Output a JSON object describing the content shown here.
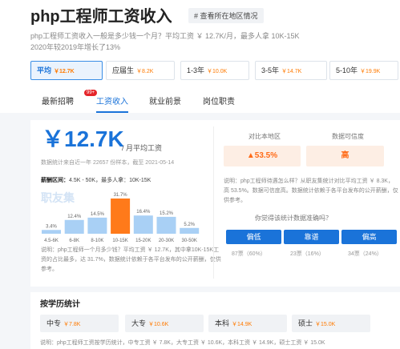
{
  "header": {
    "title": "php工程师工资收入",
    "region_link": "# 查看所在地区情况",
    "desc_line1": "php工程师工资收入一般是多少钱一个月？平均工资 ￥ 12.7K/月，最多人拿 10K-15K",
    "desc_line2": "2020年较2019年增长了13%"
  },
  "experience": [
    {
      "label": "平均",
      "value": "￥12.7K"
    },
    {
      "label": "应届生",
      "value": "￥8.2K"
    },
    {
      "label": "1-3年",
      "value": "￥10.0K"
    },
    {
      "label": "3-5年",
      "value": "￥14.7K"
    },
    {
      "label": "5-10年",
      "value": "￥19.9K"
    }
  ],
  "tabs": [
    {
      "label": "最新招聘",
      "badge": "99+"
    },
    {
      "label": "工资收入"
    },
    {
      "label": "就业前景"
    },
    {
      "label": "岗位职责"
    }
  ],
  "summary": {
    "salary": "￥12.7K",
    "unit": "/ 月平均工资",
    "stat": "数据统计来自近一年 22657 份样本，截至 2021-05-14",
    "range_label": "薪酬区间：",
    "range_text": "4.5K - 50K，最多人拿：10K-15K",
    "watermark": "职友集",
    "note": "说明：php工程师一个月多少钱？平均工资 ￥ 12.7K，其中拿10K-15K工资的占比最多，达 31.7%，数据统计依赖于各平台发布的公开薪酬，仅供参考。"
  },
  "chart_data": {
    "type": "bar",
    "categories": [
      "4.5-6K",
      "6-8K",
      "8-10K",
      "10-15K",
      "15-20K",
      "20-30K",
      "30-50K"
    ],
    "values": [
      3.4,
      12.4,
      14.5,
      31.7,
      16.4,
      15.2,
      5.2
    ],
    "labels": [
      "3.4%",
      "12.4%",
      "14.5%",
      "31.7%",
      "16.4%",
      "15.2%",
      "5.2%"
    ],
    "highlight_index": 3,
    "colors": {
      "normal": "#a9d0f5",
      "highlight": "#ff7a1a"
    }
  },
  "compare": {
    "local_label": "对比本地区",
    "local_value": "▲53.5%",
    "cred_label": "数据可信度",
    "cred_value": "高",
    "note": "说明：php工程师待遇怎么样？从职友集统计对比平均工资 ￥ 8.3K，高 53.5%。数据可信度高。数据统计依赖于各平台发布的公开薪酬，仅供参考。",
    "question": "你觉得该统计数据准确吗？",
    "votes": [
      {
        "label": "偏低",
        "count": "87票（60%）"
      },
      {
        "label": "靠谱",
        "count": "23票（16%）"
      },
      {
        "label": "偏高",
        "count": "34票（24%）"
      }
    ]
  },
  "education": {
    "title": "按学历统计",
    "items": [
      {
        "label": "中专",
        "value": "￥7.8K"
      },
      {
        "label": "大专",
        "value": "￥10.6K"
      },
      {
        "label": "本科",
        "value": "￥14.9K"
      },
      {
        "label": "硕士",
        "value": "￥15.0K"
      }
    ],
    "note": "说明：php工程师工资按学历统计，中专工资 ￥ 7.8K，大专工资 ￥ 10.6K，本科工资 ￥ 14.9K，硕士工资 ￥ 15.0K"
  }
}
